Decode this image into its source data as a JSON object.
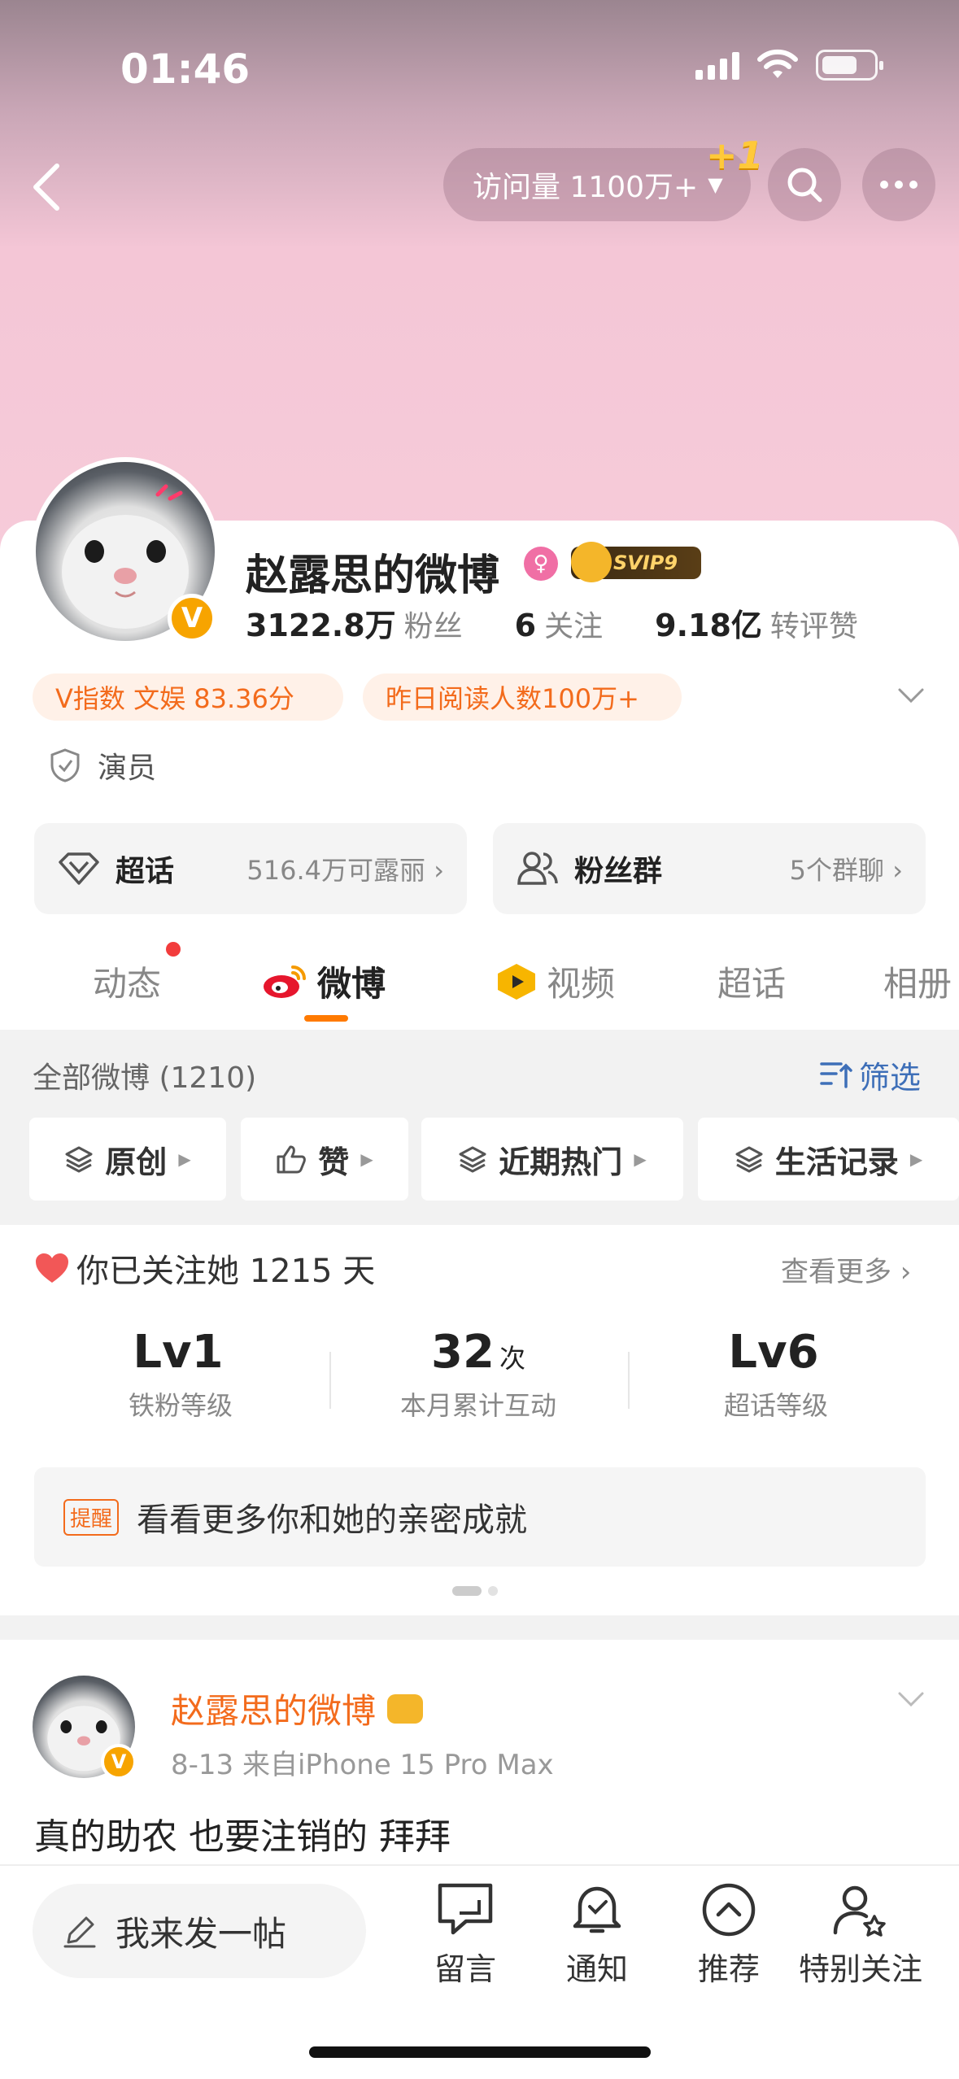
{
  "status_bar": {
    "time": "01:46"
  },
  "header": {
    "visits_label": "访问量 1100万+",
    "plus_one": "+1"
  },
  "profile": {
    "name": "赵露思的微博",
    "vbadge": "V",
    "svip": "SVIP9",
    "stats": [
      {
        "value": "3122.8万",
        "label": "粉丝"
      },
      {
        "value": "6",
        "label": "关注"
      },
      {
        "value": "9.18亿",
        "label": "转评赞"
      }
    ],
    "tags": [
      "V指数 文娱 83.36分",
      "昨日阅读人数100万+"
    ],
    "role": "演员",
    "entries": [
      {
        "title": "超话",
        "sub": "516.4万可露丽"
      },
      {
        "title": "粉丝群",
        "sub": "5个群聊"
      }
    ]
  },
  "tabs": [
    "动态",
    "微博",
    "视频",
    "超话",
    "相册"
  ],
  "feed": {
    "all_label": "全部微博 (1210)",
    "filter_label": "筛选",
    "chips": [
      "原创",
      "赞",
      "近期热门",
      "生活记录"
    ]
  },
  "fan_block": {
    "follow_days": "你已关注她 1215 天",
    "view_more": "查看更多",
    "stats": [
      {
        "value": "Lv1",
        "unit": "",
        "label": "铁粉等级"
      },
      {
        "value": "32",
        "unit": "次",
        "label": "本月累计互动"
      },
      {
        "value": "Lv6",
        "unit": "",
        "label": "超话等级"
      }
    ],
    "remind_tag": "提醒",
    "remind_text": "看看更多你和她的亲密成就"
  },
  "post": {
    "author": "赵露思的微博",
    "meta": "8-13  来自iPhone 15 Pro Max",
    "text": "真的助农 也要注销的 拜拜"
  },
  "bottom_bar": {
    "compose": "我来发一帖",
    "items": [
      "留言",
      "通知",
      "推荐",
      "特别关注"
    ]
  },
  "colors": {
    "accent": "#f36b1c",
    "link": "#3e6fb8",
    "hero_pink": "#f6cbd9",
    "underline": "#ff7a00"
  }
}
